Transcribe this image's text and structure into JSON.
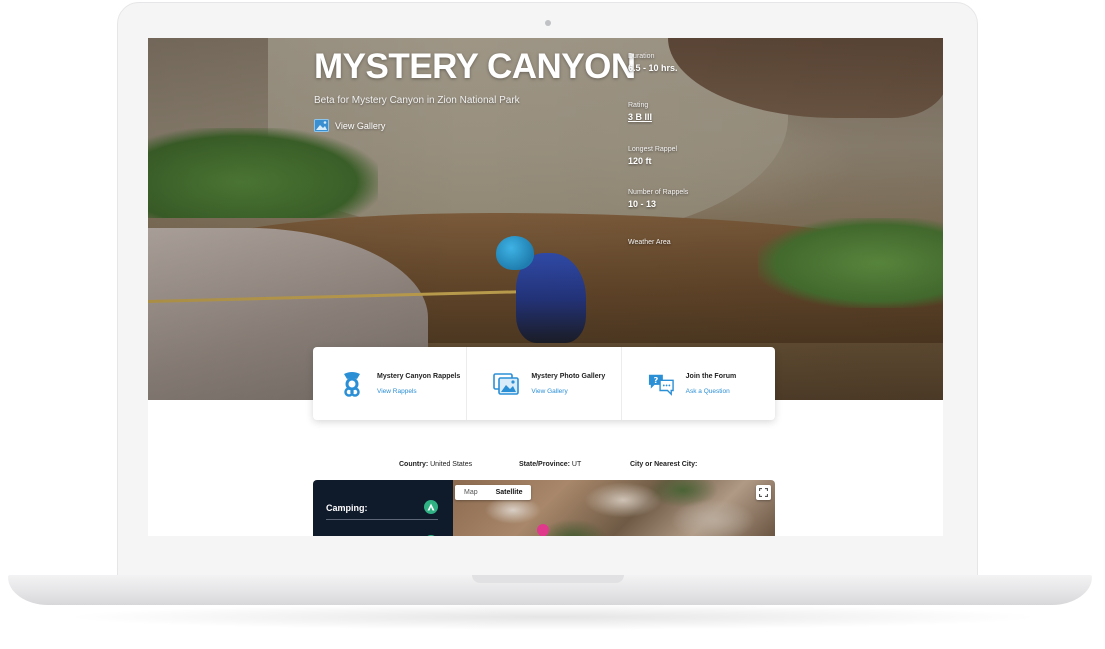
{
  "hero": {
    "title": "MYSTERY CANYON",
    "subtitle": "Beta for Mystery Canyon in Zion National Park",
    "gallery_link": "View Gallery"
  },
  "stats": [
    {
      "label": "Duration",
      "value": "6.5 - 10 hrs."
    },
    {
      "label": "Rating",
      "value": "3 B III"
    },
    {
      "label": "Longest Rappel",
      "value": "120 ft"
    },
    {
      "label": "Number of Rappels",
      "value": "10 - 13"
    },
    {
      "label": "Weather Area",
      "value": ""
    }
  ],
  "cards": [
    {
      "title": "Mystery Canyon Rappels",
      "link": "View Rappels",
      "icon": "rappel-icon"
    },
    {
      "title": "Mystery Photo Gallery",
      "link": "View Gallery",
      "icon": "gallery-icon"
    },
    {
      "title": "Join the Forum",
      "link": "Ask a Question",
      "icon": "chat-icon"
    }
  ],
  "location": {
    "country_label": "Country:",
    "country_value": "United States",
    "state_label": "State/Province:",
    "state_value": "UT",
    "city_label": "City or Nearest City:",
    "city_value": ""
  },
  "camping": {
    "title": "Camping:"
  },
  "map": {
    "map_label": "Map",
    "satellite_label": "Satellite",
    "active": "Satellite"
  },
  "colors": {
    "link": "#2b8fd6",
    "panel": "#0f1a2b",
    "camping_icon": "#2fb184",
    "pin": "#e0398c"
  }
}
